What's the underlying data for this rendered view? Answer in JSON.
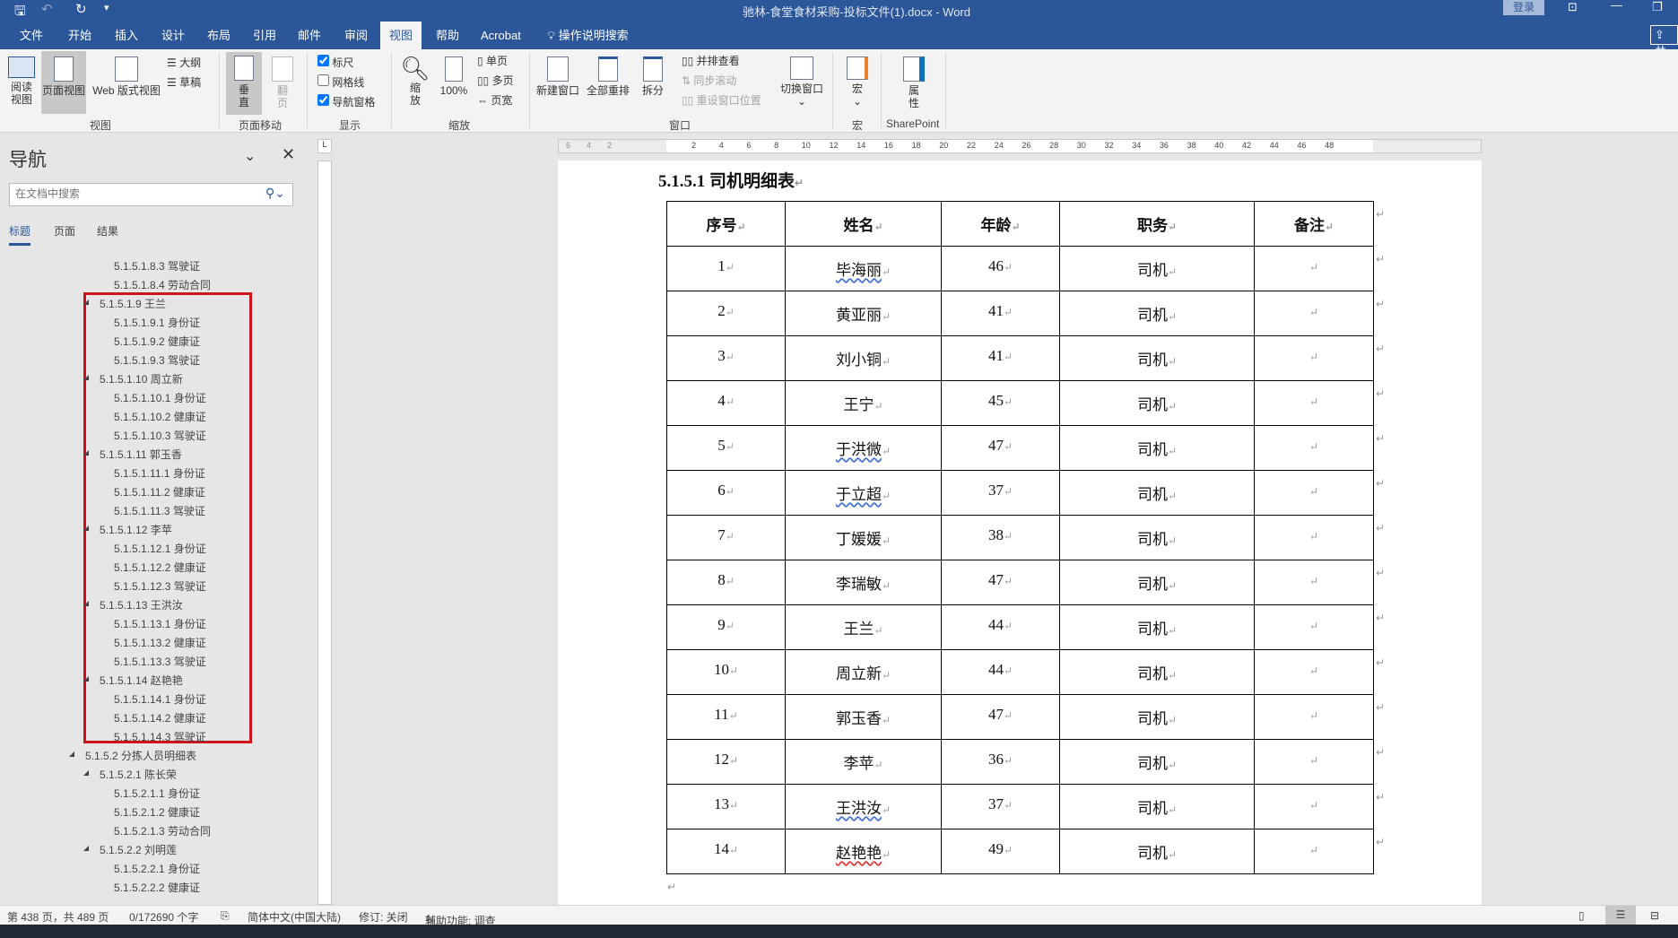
{
  "titlebar": {
    "title": "驰林-食堂食材采购-投标文件(1).docx  -  Word",
    "login": "登录",
    "share": "共"
  },
  "tabs": [
    "文件",
    "开始",
    "插入",
    "设计",
    "布局",
    "引用",
    "邮件",
    "审阅",
    "视图",
    "帮助",
    "Acrobat"
  ],
  "active_tab": "视图",
  "tell_me": "操作说明搜索",
  "ribbon": {
    "views": {
      "read": "阅读\n视图",
      "print": "页面视图",
      "web": "Web 版式视图",
      "outline": "大纲",
      "draft": "草稿",
      "group": "视图"
    },
    "page_move": {
      "vertical": "垂\n直",
      "side": "翻\n页",
      "group": "页面移动"
    },
    "show": {
      "ruler": "标尺",
      "ruler_checked": true,
      "gridlines": "网格线",
      "gridlines_checked": false,
      "navpane": "导航窗格",
      "navpane_checked": true,
      "group": "显示"
    },
    "zoom": {
      "zoom": "缩\n放",
      "hundred": "100%",
      "one_page": "单页",
      "multi_page": "多页",
      "page_width": "页宽",
      "group": "缩放"
    },
    "window": {
      "new": "新建窗口",
      "arrange": "全部重排",
      "split": "拆分",
      "side_by_side": "并排查看",
      "sync": "同步滚动",
      "reset": "重设窗口位置",
      "switch": "切换窗口",
      "group": "窗口"
    },
    "macros": {
      "macros": "宏",
      "group": "宏"
    },
    "sharepoint": {
      "properties": "属\n性",
      "group": "SharePoint"
    }
  },
  "nav": {
    "title": "导航",
    "search_placeholder": "在文档中搜索",
    "tabs": [
      "标题",
      "页面",
      "结果"
    ],
    "active_tab": "标题",
    "items": [
      {
        "label": "5.1.5.1.8.3 驾驶证",
        "level": 5
      },
      {
        "label": "5.1.5.1.8.4 劳动合同",
        "level": 5
      },
      {
        "label": "5.1.5.1.9 王兰",
        "level": 4
      },
      {
        "label": "5.1.5.1.9.1 身份证",
        "level": 5
      },
      {
        "label": "5.1.5.1.9.2 健康证",
        "level": 5
      },
      {
        "label": "5.1.5.1.9.3 驾驶证",
        "level": 5
      },
      {
        "label": "5.1.5.1.10 周立新",
        "level": 4
      },
      {
        "label": "5.1.5.1.10.1 身份证",
        "level": 5
      },
      {
        "label": "5.1.5.1.10.2 健康证",
        "level": 5
      },
      {
        "label": "5.1.5.1.10.3 驾驶证",
        "level": 5
      },
      {
        "label": "5.1.5.1.11 郭玉香",
        "level": 4
      },
      {
        "label": "5.1.5.1.11.1 身份证",
        "level": 5
      },
      {
        "label": "5.1.5.1.11.2 健康证",
        "level": 5
      },
      {
        "label": "5.1.5.1.11.3 驾驶证",
        "level": 5
      },
      {
        "label": "5.1.5.1.12 李苹",
        "level": 4
      },
      {
        "label": "5.1.5.1.12.1 身份证",
        "level": 5
      },
      {
        "label": "5.1.5.1.12.2 健康证",
        "level": 5
      },
      {
        "label": "5.1.5.1.12.3 驾驶证",
        "level": 5
      },
      {
        "label": "5.1.5.1.13 王洪汝",
        "level": 4
      },
      {
        "label": "5.1.5.1.13.1 身份证",
        "level": 5
      },
      {
        "label": "5.1.5.1.13.2 健康证",
        "level": 5
      },
      {
        "label": "5.1.5.1.13.3 驾驶证",
        "level": 5
      },
      {
        "label": "5.1.5.1.14 赵艳艳",
        "level": 4
      },
      {
        "label": "5.1.5.1.14.1 身份证",
        "level": 5
      },
      {
        "label": "5.1.5.1.14.2 健康证",
        "level": 5
      },
      {
        "label": "5.1.5.1.14.3 驾驶证",
        "level": 5
      },
      {
        "label": "5.1.5.2 分拣人员明细表",
        "level": 3
      },
      {
        "label": "5.1.5.2.1 陈长荣",
        "level": 4
      },
      {
        "label": "5.1.5.2.1.1 身份证",
        "level": 5
      },
      {
        "label": "5.1.5.2.1.2 健康证",
        "level": 5
      },
      {
        "label": "5.1.5.2.1.3 劳动合同",
        "level": 5
      },
      {
        "label": "5.1.5.2.2 刘明莲",
        "level": 4
      },
      {
        "label": "5.1.5.2.2.1 身份证",
        "level": 5
      },
      {
        "label": "5.1.5.2.2.2 健康证",
        "level": 5
      }
    ],
    "highlight_color": "#d0121b"
  },
  "document": {
    "heading": "5.1.5.1  司机明细表",
    "columns": [
      "序号",
      "姓名",
      "年龄",
      "职务",
      "备注"
    ],
    "rows": [
      [
        "1",
        "毕海丽",
        "46",
        "司机",
        ""
      ],
      [
        "2",
        "黄亚丽",
        "41",
        "司机",
        ""
      ],
      [
        "3",
        "刘小铜",
        "41",
        "司机",
        ""
      ],
      [
        "4",
        "王宁",
        "45",
        "司机",
        ""
      ],
      [
        "5",
        "于洪微",
        "47",
        "司机",
        ""
      ],
      [
        "6",
        "于立超",
        "37",
        "司机",
        ""
      ],
      [
        "7",
        "丁媛媛",
        "38",
        "司机",
        ""
      ],
      [
        "8",
        "李瑞敏",
        "47",
        "司机",
        ""
      ],
      [
        "9",
        "王兰",
        "44",
        "司机",
        ""
      ],
      [
        "10",
        "周立新",
        "44",
        "司机",
        ""
      ],
      [
        "11",
        "郭玉香",
        "47",
        "司机",
        ""
      ],
      [
        "12",
        "李苹",
        "36",
        "司机",
        ""
      ],
      [
        "13",
        "王洪汝",
        "37",
        "司机",
        ""
      ],
      [
        "14",
        "赵艳艳",
        "49",
        "司机",
        ""
      ]
    ],
    "ruler_numbers": [
      "6",
      "4",
      "2",
      "2",
      "4",
      "6",
      "8",
      "10",
      "12",
      "14",
      "16",
      "18",
      "20",
      "22",
      "24",
      "26",
      "28",
      "30",
      "32",
      "34",
      "36",
      "38",
      "40",
      "42",
      "44",
      "46",
      "48"
    ]
  },
  "status": {
    "page": "第 438 页，共 489 页",
    "words": "0/172690 个字",
    "language": "简体中文(中国大陆)",
    "track": "修订: 关闭",
    "accessibility": "辅助功能: 调查"
  },
  "colors": {
    "brand": "#2b579a",
    "ribbon_bg": "#f3f3f3"
  }
}
